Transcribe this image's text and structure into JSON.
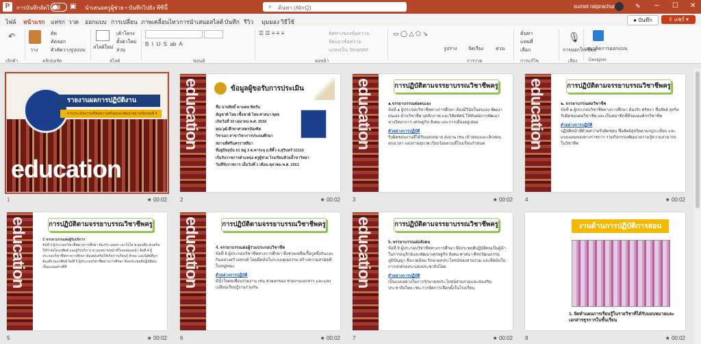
{
  "titlebar": {
    "autosave_label": "การบันทึกอัตโนมัติ",
    "doc_title": "นำเสนอครูผู้ช่วย • บันทึกไปยัง พีซีนี้",
    "search_placeholder": "ค้นหา (Alt+Q)",
    "user_name": "sumet ratprachum"
  },
  "tabs": [
    "ไฟล์",
    "หน้าแรก",
    "แทรก",
    "วาด",
    "ออกแบบ",
    "การเปลี่ยน",
    "ภาพเคลื่อนไหว",
    "การนำเสนอสไลด์",
    "บันทึก",
    "รีวิว",
    "มุมมอง",
    "วิธีใช้"
  ],
  "tab_actions": {
    "record": "บันทึก",
    "share": "แชร์"
  },
  "ribbon": {
    "groups": [
      "เลิกทำ",
      "คลิปบอร์ด",
      "สไลด์",
      "ฟอนต์",
      "ย่อหน้า",
      "การวาด",
      "การแก้ไข",
      "เสียง",
      "Designer"
    ],
    "clipboard": {
      "paste": "วาง",
      "cut": "ตัด",
      "copy": "คัดลอก",
      "format_painter": "ตัวคัดวางรูปแบบ"
    },
    "slides": {
      "new_slide": "สไลด์ใหม่",
      "layout": "เค้าโครง",
      "reset": "ตั้งค่าใหม่",
      "section": "ส่วน"
    },
    "paragraph": {
      "text_direction": "ทิศทางของข้อความ",
      "align_text": "จัดแนวข้อความ",
      "smartart": "แปลงเป็น SmartArt"
    },
    "drawing": {
      "shapes": "รูปร่าง",
      "arrange": "จัดเรียง",
      "quick_styles": "ด่วน"
    },
    "editing": {
      "find": "ค้นหา",
      "replace": "แทนที่",
      "select": "เลือก"
    },
    "voice": {
      "dictate": "การบอกให้เขียน"
    },
    "designer": {
      "design_ideas": "แนวคิดการออกแบบ"
    }
  },
  "slides": [
    {
      "num": "1",
      "duration": "★ 00:02",
      "title": "รายงานผลการปฏิบัติงาน",
      "subtitle": "การประเมินการเตรียมความพร้อมและพัฒนาอย่างเข้มรอบที่ 4",
      "word": "education"
    },
    {
      "num": "2",
      "duration": "★ 00:02",
      "title": "ข้อมูลผู้ขอรับการประเมิน",
      "lines": [
        "ชื่อ นายสิทธิ์ พาฆคล พิทรัน",
        "สัญชาติ ไทย เชื้อชาติ ไทย ศาสนา พุทธ",
        "เกิดวันที่ 30 เมษายน พ.ศ. 2536",
        "คุณวุฒิ ศึกษาศาสตรบัณฑิต",
        "วิชาเอก สาขาวิชาการประถมศึกษา",
        "สถานที่ศรีนครราชสีมา",
        "ที่อยู่ปัจจุบัน 61 หมู่ 3 ต.พาระจุ อ.สีคิ้ว จ.สุรินทร์ 32110",
        "เริ่มรับราชการตำแหน่ง ครูผู้ช่วย โรงเรียนห้วยน้ำขาวิทยา",
        "วันที่รับราชการ เมื่อวันที่ 1 เดือน ตุลาคม พ.ศ. 2561"
      ]
    },
    {
      "num": "3",
      "duration": "★ 00:02",
      "title": "การปฏิบัติตามจรรยาบรรณวิชาชีพครู",
      "h": "๑.จรรยาบรรณต่อตนเอง",
      "p": "ข้อที่ ๑ ผู้ประกอบวิชาชีพทางการศึกษา ต้องมีวินัยในตนเอง พัฒนาตนเอง ด้านวิชาชีพ บุคลิกภาพ และวิสัยทัศน์ ให้ทันต่อการพัฒนา ทางวิทยาการ เศรษฐกิจ สังคม และการเมืองอยู่เสมอ",
      "ex": "ตัวอย่างการปฏิบัติ",
      "p2": "รับผิดชอบงานที่ได้รับมอบหมาย ส่งงาน เช่น เข้าสอนและเลิกสอนตรงเวลา แต่งกายสุภาพ เรียบร้อยตามที่โรงเรียนกำหนด"
    },
    {
      "num": "4",
      "duration": "★ 00:02",
      "title": "การปฏิบัติตามจรรยาบรรณวิชาชีพครู",
      "h": "๒. จรรยาบรรณต่อวิชาชีพ",
      "p": "ข้อที่ ๒ ผู้ประกอบวิชาชีพทางการศึกษา ต้องรัก ศรัทธา ซื่อสัตย์ สุจริต รับผิดชอบต่อวิชาชีพ และเป็นสมาชิกที่ดีขององค์กรวิชาชีพ",
      "ex": "ตัวอย่างการปฏิบัติ",
      "p2": "ปฏิบัติหน้าที่ด้วยความรับผิดชอบ ซื่อสัตย์สุจริตตามกฎระเบียบ และแบบแผนของทางราชการ ร่วมกิจกรรมพัฒนาความรู้ความสามารถในวิชาชีพ"
    },
    {
      "num": "5",
      "duration": "★ 00:02",
      "title": "การปฏิบัติตามจรรยาบรรณวิชาชีพครู",
      "h": "3. จรรยาบรรณต่อผู้รับบริการ",
      "p": "ข้อที่ 3 ผู้ประกอบวิชาชีพทางการศึกษา ต้องรัก เมตตา เอาใจใส่ ช่วยเหลือ ส่งเสริม ให้กำลังใจแก่ศิษย์ และผู้รับบริการ ตามบทบาทหน้าที่โดยเสมอหน้า ข้อที่ 4 ผู้ประกอบวิชาชีพทางการศึกษา ต้องส่งเสริมให้เกิดการเรียนรู้ ทักษะ และนิสัยที่ถูกต้องดีงามแก่ศิษย์ ข้อที่ 5 ผู้ประกอบวิชาชีพทางการศึกษา ต้องประพฤติปฏิบัติตนเป็นแบบอย่างที่ดี",
      "ex": "",
      "p2": ""
    },
    {
      "num": "6",
      "duration": "★ 00:02",
      "title": "การปฏิบัติตามจรรยาบรรณวิชาชีพครู",
      "h": "4. จรรยาบรรณต่อผู้ร่วมประกอบวิชาชีพ",
      "p": "ข้อที่ 8 ผู้ประกอบวิชาชีพทางการศึกษา พึงช่วยเหลือเกื้อกูลซึ่งกันและกันอย่างสร้างสรรค์ โดยยึดมั่นในระบบคุณธรรม สร้างความสามัคคีในหมู่คณะ",
      "ex": "ตัวอย่างการปฏิบัติ",
      "p2": "มีน้ำใจต่อเพื่อนร่วมงาน เช่น ช่วยยกของ ช่วยงานเอกสาร และแลกเปลี่ยนเรียนรู้งานร่วมกัน"
    },
    {
      "num": "7",
      "duration": "★ 00:02",
      "title": "การปฏิบัติตามจรรยาบรรณวิชาชีพครู",
      "h": "5. จรรยาบรรณต่อสังคม",
      "p": "ข้อที่ 9 ผู้ประกอบวิชาชีพทางการศึกษา พึงประพฤติปฏิบัติตนเป็นผู้นำในการอนุรักษ์และพัฒนาเศรษฐกิจ สังคม ศาสนา ศิลปวัฒนธรรม ภูมิปัญญา สิ่งแวดล้อม รักษาผลประโยชน์ของส่วนรวม และยึดมั่นในการปกครองระบอบประชาธิปไตย",
      "ex": "ตัวอย่างการปฏิบัติ",
      "p2": "เป็นแบบอย่างในการรักษาคลประโยชน์ส่วนรวมและส่งเสริมประชาธิปไตย เช่น การจัดการเลือกตั้งในโรงเรียน"
    },
    {
      "num": "8",
      "duration": "★ 00:02",
      "title": "งานด้านการปฏิบัติการสอน",
      "caption": "1. จัดทำแผนการเรียนรู้ในรายวิชาที่ได้รับมอบหมายและเอกสารธุรการในชั้นเรียน"
    }
  ],
  "colors": {
    "accent": "#b7472a",
    "green": "#8bc34a",
    "gold": "#f5b800"
  }
}
